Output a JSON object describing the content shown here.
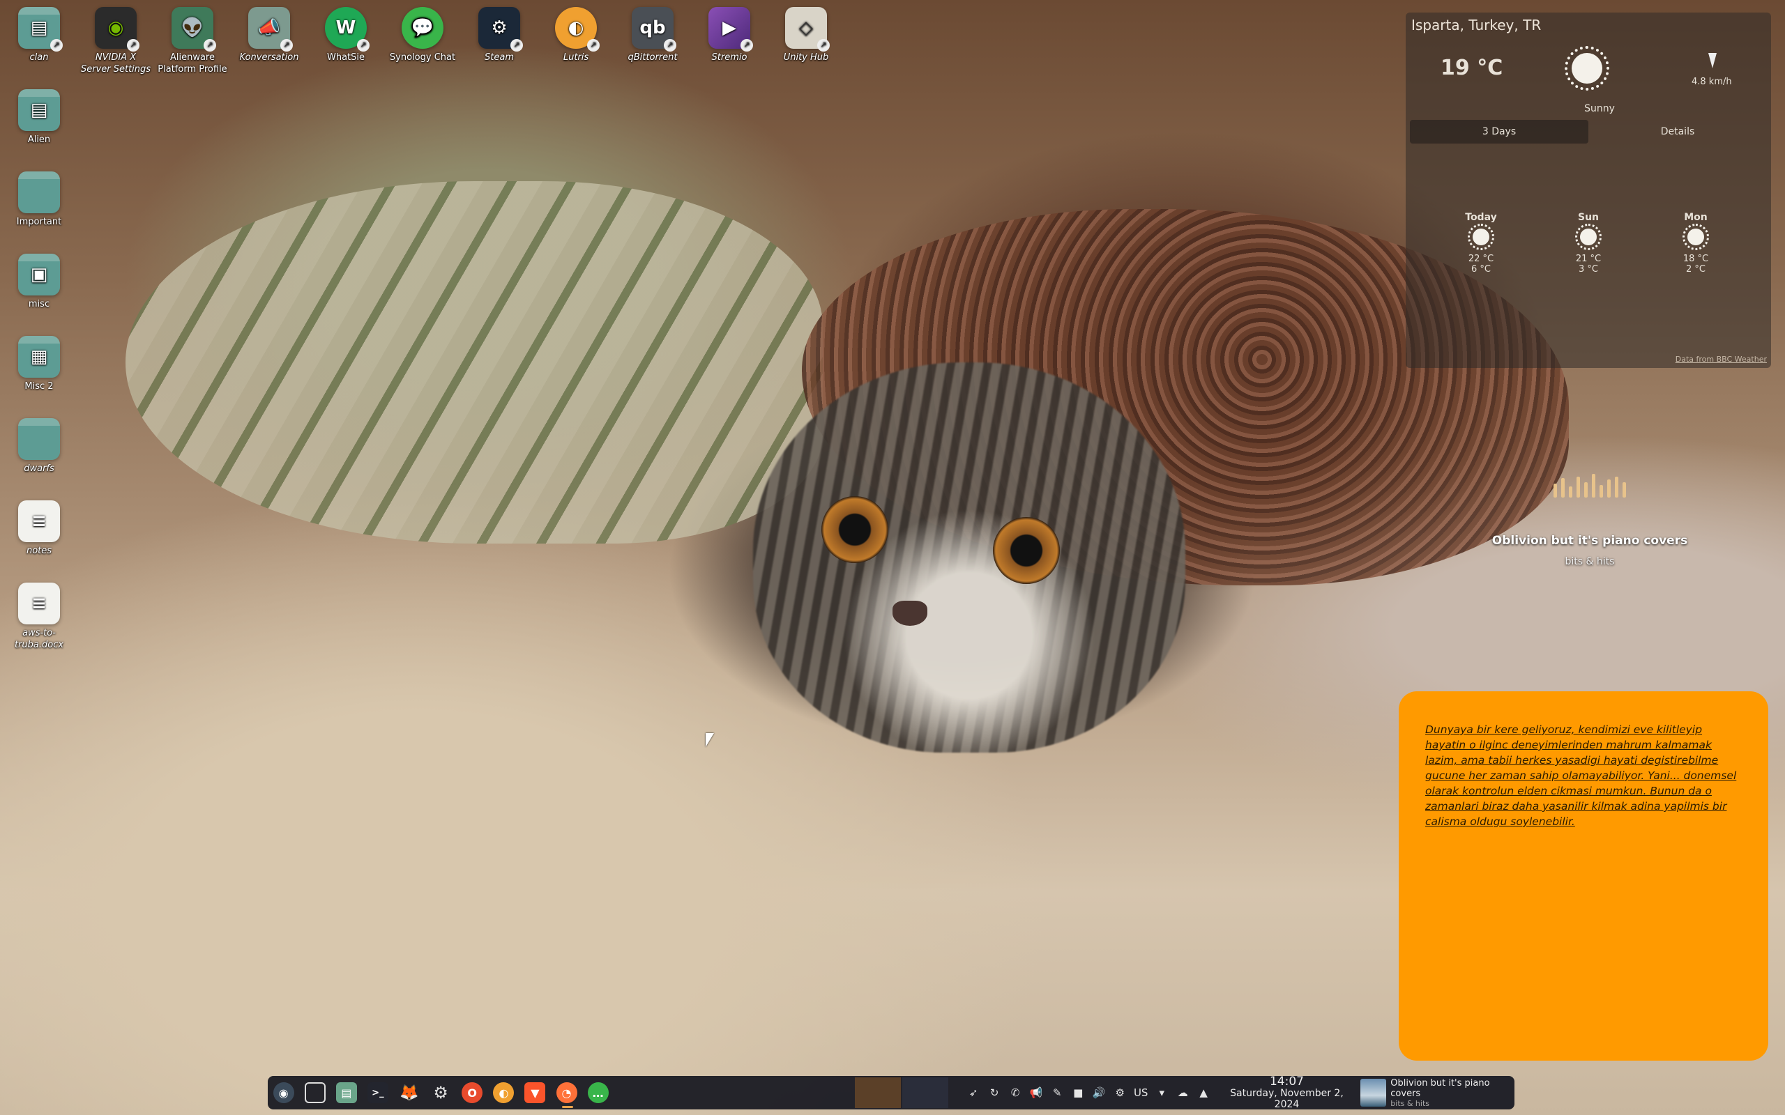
{
  "desktop_icons_top": [
    {
      "name": "clan",
      "label": "clan"
    },
    {
      "name": "nvidia-x-server-settings",
      "label": "NVIDIA X Server Settings"
    },
    {
      "name": "alienware-platform-profile",
      "label": "Alienware Platform Profile"
    },
    {
      "name": "konversation",
      "label": "Konversation"
    },
    {
      "name": "whatsie",
      "label": "WhatSie"
    },
    {
      "name": "synology-chat",
      "label": "Synology Chat"
    },
    {
      "name": "steam",
      "label": "Steam"
    },
    {
      "name": "lutris",
      "label": "Lutris"
    },
    {
      "name": "qbittorrent",
      "label": "qBittorrent"
    },
    {
      "name": "stremio",
      "label": "Stremio"
    },
    {
      "name": "unity-hub",
      "label": "Unity Hub"
    }
  ],
  "desktop_icons_left": [
    {
      "name": "alien",
      "label": "Alien"
    },
    {
      "name": "important",
      "label": "Important"
    },
    {
      "name": "misc",
      "label": "misc"
    },
    {
      "name": "misc-2",
      "label": "Misc 2"
    },
    {
      "name": "dwarfs",
      "label": "dwarfs"
    },
    {
      "name": "notes",
      "label": "notes"
    },
    {
      "name": "aws-to-truba-docx",
      "label": "aws-to-truba.docx"
    }
  ],
  "weather": {
    "location": "Isparta, Turkey, TR",
    "temperature": "19 °C",
    "condition": "Sunny",
    "wind": "4.8 km/h",
    "tabs": [
      "3 Days",
      "Details"
    ],
    "days": [
      {
        "name": "Today",
        "high": "22 °C",
        "low": "6 °C"
      },
      {
        "name": "Sun",
        "high": "21 °C",
        "low": "3 °C"
      },
      {
        "name": "Mon",
        "high": "18 °C",
        "low": "2 °C"
      }
    ],
    "source": "Data from BBC Weather"
  },
  "media": {
    "title": "Oblivion but it's piano covers",
    "artist": "bits & hits"
  },
  "note": {
    "text": "Dunyaya bir kere geliyoruz, kendimizi eve kilitleyip hayatin o ilginc deneyimlerinden mahrum kalmamak lazim, ama tabii herkes yasadigi hayati degistirebilme gucune her zaman sahip olamayabiliyor. Yani... donemsel olarak kontrolun elden cikmasi mumkun. Bunun da o zamanlari biraz daha yasanilir kilmak adina yapilmis bir calisma oldugu soylenebilir."
  },
  "taskbar": {
    "apps": [
      "app-launcher",
      "show-desktop",
      "file-manager",
      "terminal",
      "gitlab",
      "system-settings",
      "opera",
      "lutris",
      "brave",
      "firefox",
      "synology-chat"
    ],
    "keyboard_layout": "US",
    "time": "14:07",
    "date": "Saturday, November 2, 2024",
    "player_title": "Oblivion but it's piano covers",
    "player_artist": "bits & hits"
  },
  "colors": {
    "note_bg": "#ff9a00",
    "taskbar_bg": "#181a22",
    "weather_bg": "#322c28"
  }
}
